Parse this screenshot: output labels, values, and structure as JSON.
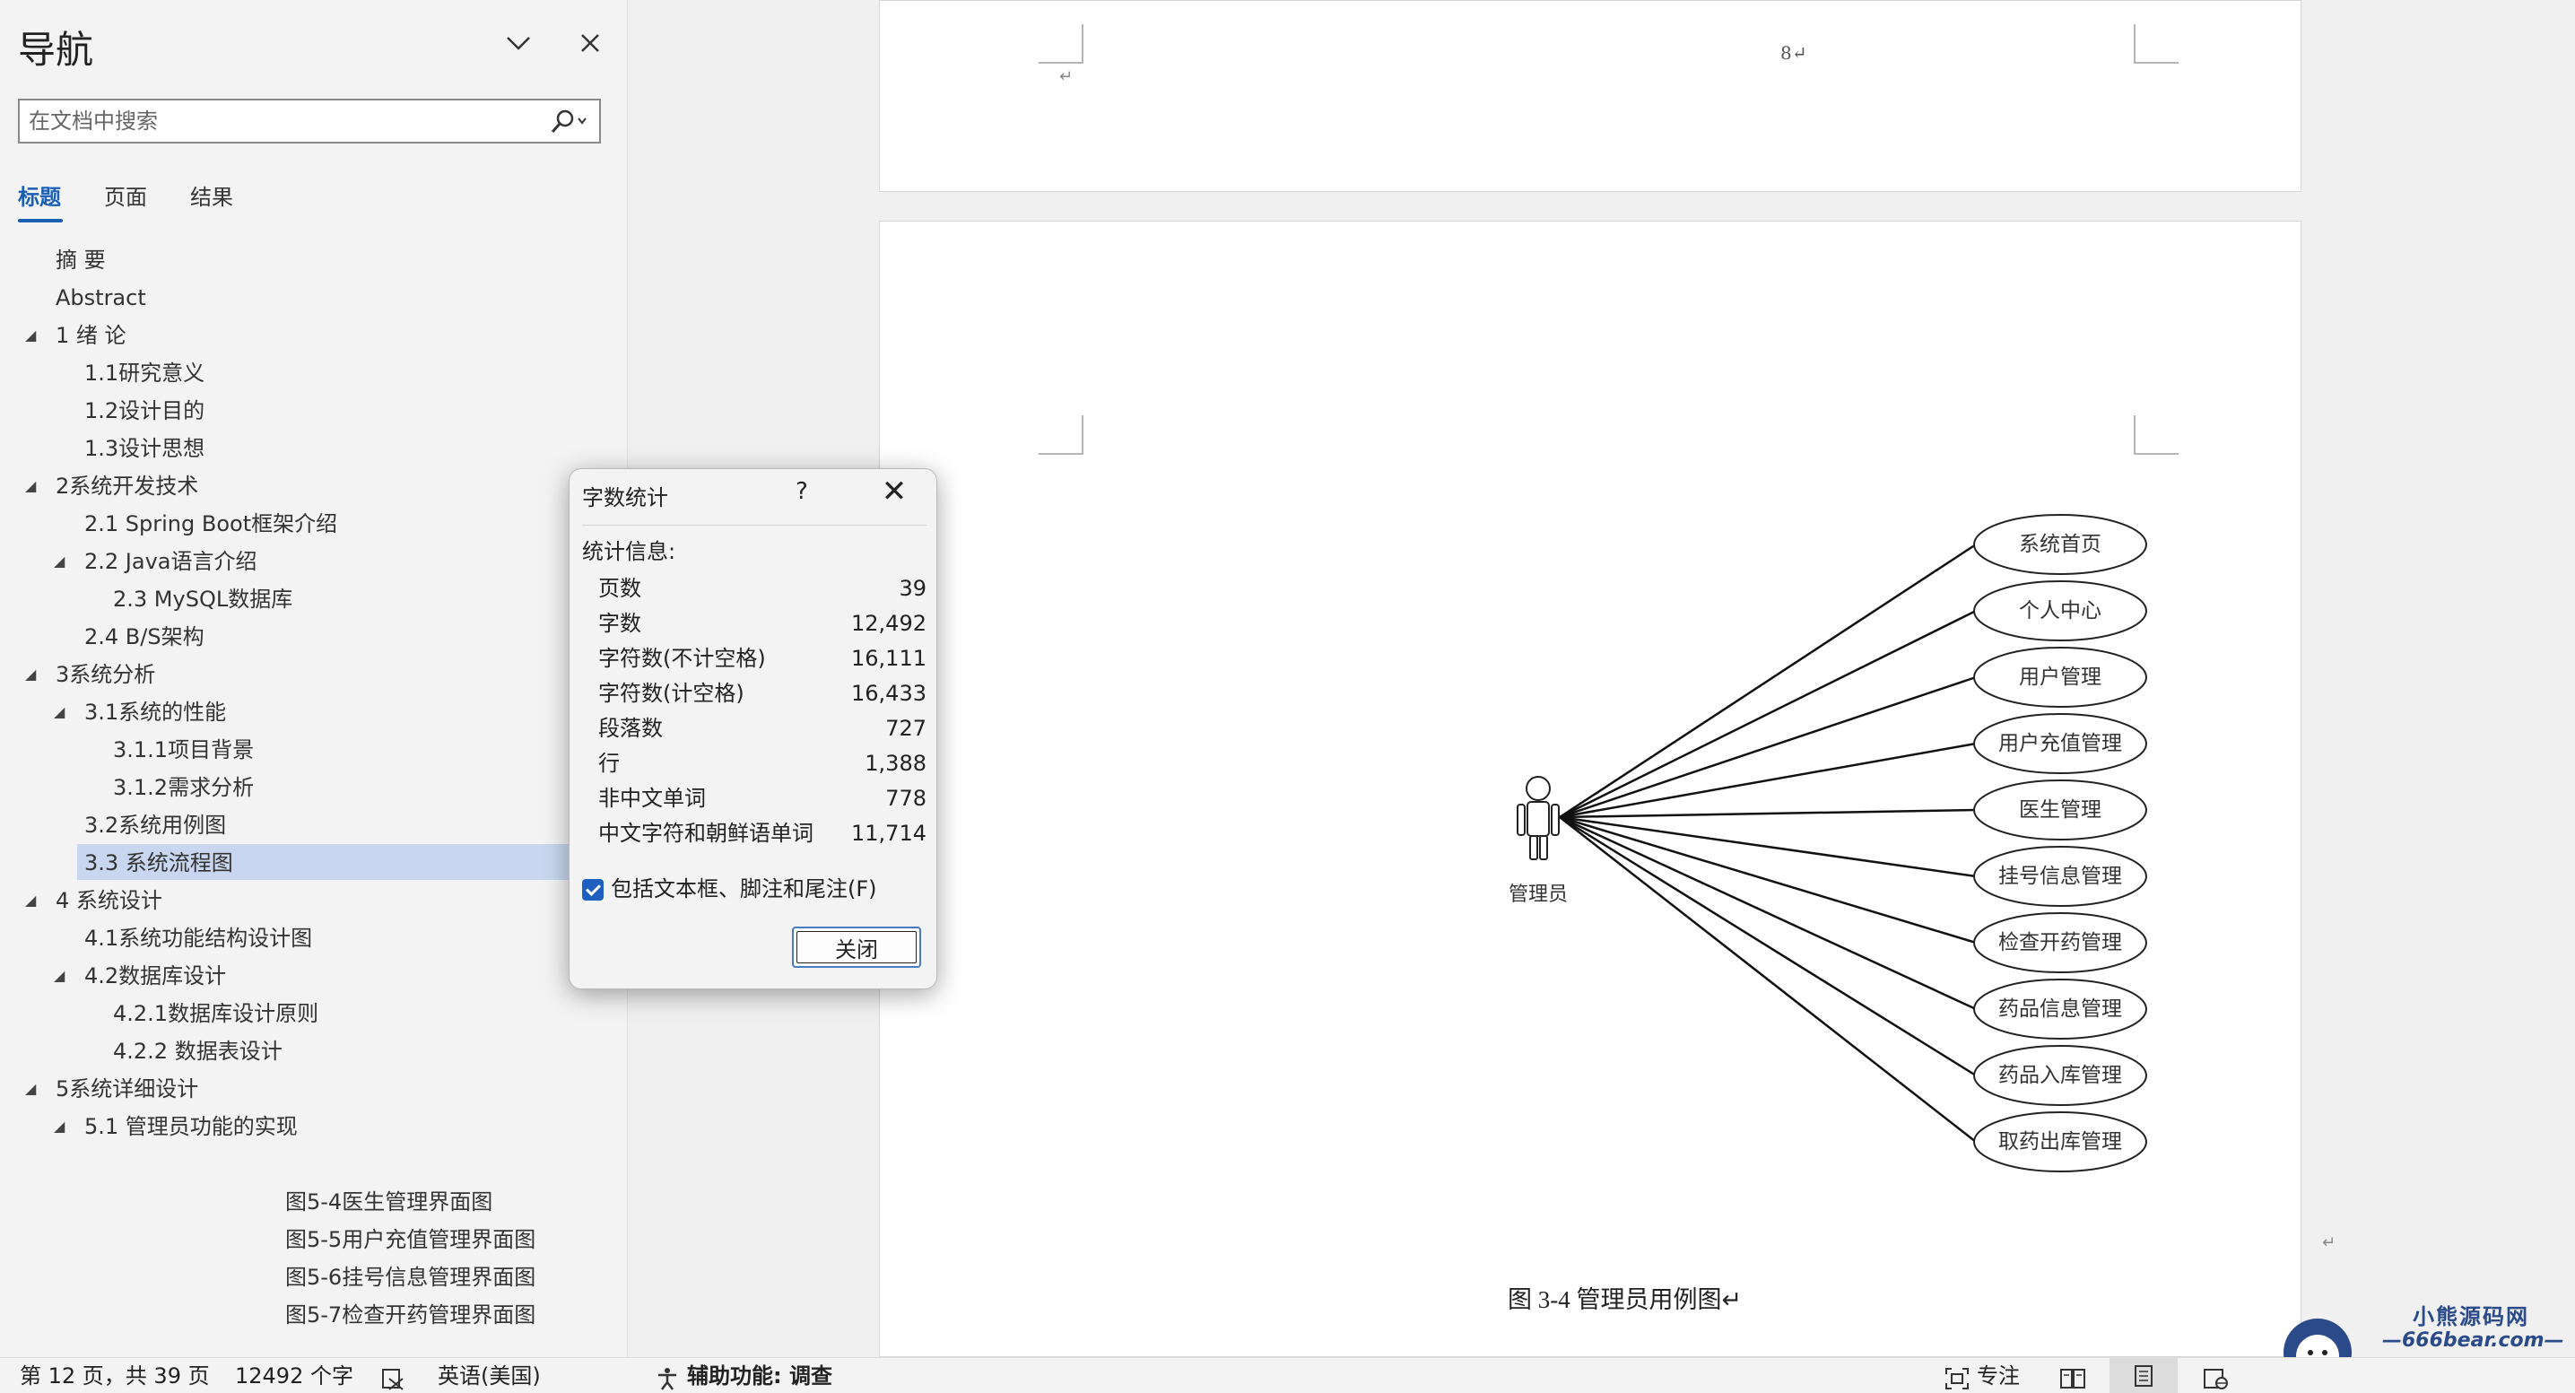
{
  "nav": {
    "title": "导航",
    "search_placeholder": "在文档中搜索",
    "tabs": [
      "标题",
      "页面",
      "结果"
    ],
    "headings": [
      {
        "text": "摘  要",
        "level": 1,
        "expand": false
      },
      {
        "text": "Abstract",
        "level": 1,
        "expand": false
      },
      {
        "text": "1 绪  论",
        "level": 1,
        "expand": true
      },
      {
        "text": "1.1研究意义",
        "level": 2,
        "expand": false
      },
      {
        "text": "1.2设计目的",
        "level": 2,
        "expand": false
      },
      {
        "text": "1.3设计思想",
        "level": 2,
        "expand": false
      },
      {
        "text": "2系统开发技术",
        "level": 1,
        "expand": true
      },
      {
        "text": "2.1 Spring Boot框架介绍",
        "level": 2,
        "expand": false
      },
      {
        "text": "2.2 Java语言介绍",
        "level": 2,
        "expand": true
      },
      {
        "text": "2.3 MySQL数据库",
        "level": 3,
        "expand": false
      },
      {
        "text": "2.4 B/S架构",
        "level": 2,
        "expand": false
      },
      {
        "text": "3系统分析",
        "level": 1,
        "expand": true
      },
      {
        "text": "3.1系统的性能",
        "level": 2,
        "expand": true
      },
      {
        "text": "3.1.1项目背景",
        "level": 3,
        "expand": false
      },
      {
        "text": "3.1.2需求分析",
        "level": 3,
        "expand": false
      },
      {
        "text": "3.2系统用例图",
        "level": 2,
        "expand": false
      },
      {
        "text": "3.3 系统流程图",
        "level": 2,
        "expand": false,
        "selected": true
      },
      {
        "text": "4 系统设计",
        "level": 1,
        "expand": true
      },
      {
        "text": "4.1系统功能结构设计图",
        "level": 2,
        "expand": false
      },
      {
        "text": "4.2数据库设计",
        "level": 2,
        "expand": true
      },
      {
        "text": "4.2.1数据库设计原则",
        "level": 3,
        "expand": false
      },
      {
        "text": "4.2.2  数据表设计",
        "level": 3,
        "expand": false
      },
      {
        "text": "5系统详细设计",
        "level": 1,
        "expand": true
      },
      {
        "text": "5.1 管理员功能的实现",
        "level": 2,
        "expand": true
      }
    ],
    "figures": [
      "图5-4医生管理界面图",
      "图5-5用户充值管理界面图",
      "图5-6挂号信息管理界面图",
      "图5-7检查开药管理界面图"
    ]
  },
  "document": {
    "page_number_text": "8↵",
    "para_mark": "↵",
    "actor_label": "管理员",
    "use_cases": [
      "系统首页",
      "个人中心",
      "用户管理",
      "用户充值管理",
      "医生管理",
      "挂号信息管理",
      "检查开药管理",
      "药品信息管理",
      "药品入库管理",
      "取药出库管理"
    ],
    "caption": "图 3-4  管理员用例图↵"
  },
  "dialog": {
    "title": "字数统计",
    "help": "?",
    "close_x": "✕",
    "section": "统计信息:",
    "stats": [
      {
        "label": "页数",
        "value": "39"
      },
      {
        "label": "字数",
        "value": "12,492"
      },
      {
        "label": "字符数(不计空格)",
        "value": "16,111"
      },
      {
        "label": "字符数(计空格)",
        "value": "16,433"
      },
      {
        "label": "段落数",
        "value": "727"
      },
      {
        "label": "行",
        "value": "1,388"
      },
      {
        "label": "非中文单词",
        "value": "778"
      },
      {
        "label": "中文字符和朝鲜语单词",
        "value": "11,714"
      }
    ],
    "checkbox_label": "包括文本框、脚注和尾注(F)",
    "checkbox_checked": true,
    "close_button": "关闭"
  },
  "status_bar": {
    "page": "第 12 页，共 39 页",
    "words": "12492 个字",
    "language": "英语(美国)",
    "accessibility": "辅助功能: 调查",
    "focus": "专注"
  },
  "watermark": {
    "line1": "小熊源码网",
    "line2": "—666bear.com—"
  },
  "colors": {
    "accent": "#1a5fb4",
    "selected_heading": "#c8d7ef",
    "checkbox": "#1f5fbf"
  }
}
